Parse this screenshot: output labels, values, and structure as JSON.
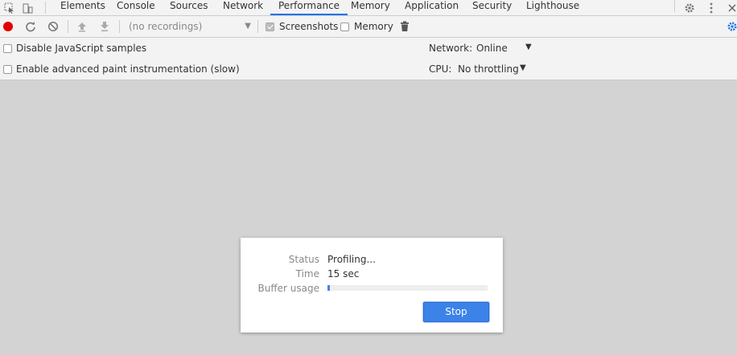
{
  "tabs": [
    {
      "label": "Elements",
      "active": false
    },
    {
      "label": "Console",
      "active": false
    },
    {
      "label": "Sources",
      "active": false
    },
    {
      "label": "Network",
      "active": false
    },
    {
      "label": "Performance",
      "active": true
    },
    {
      "label": "Memory",
      "active": false
    },
    {
      "label": "Application",
      "active": false
    },
    {
      "label": "Security",
      "active": false
    },
    {
      "label": "Lighthouse",
      "active": false
    }
  ],
  "toolbar": {
    "recordings_placeholder": "(no recordings)",
    "screenshots_label": "Screenshots",
    "screenshots_checked": true,
    "memory_label": "Memory",
    "memory_checked": false
  },
  "settings": {
    "disable_js_samples_label": "Disable JavaScript samples",
    "advanced_paint_label": "Enable advanced paint instrumentation (slow)",
    "network_label": "Network:",
    "network_value": "Online",
    "cpu_label": "CPU:",
    "cpu_value": "No throttling"
  },
  "dialog": {
    "status_label": "Status",
    "status_value": "Profiling...",
    "time_label": "Time",
    "time_value": "15 sec",
    "buffer_label": "Buffer usage",
    "buffer_fraction": 0.015,
    "stop_label": "Stop"
  },
  "colors": {
    "accent": "#1a73e8",
    "record_red": "#e00000",
    "stop_button": "#3b83e8"
  }
}
